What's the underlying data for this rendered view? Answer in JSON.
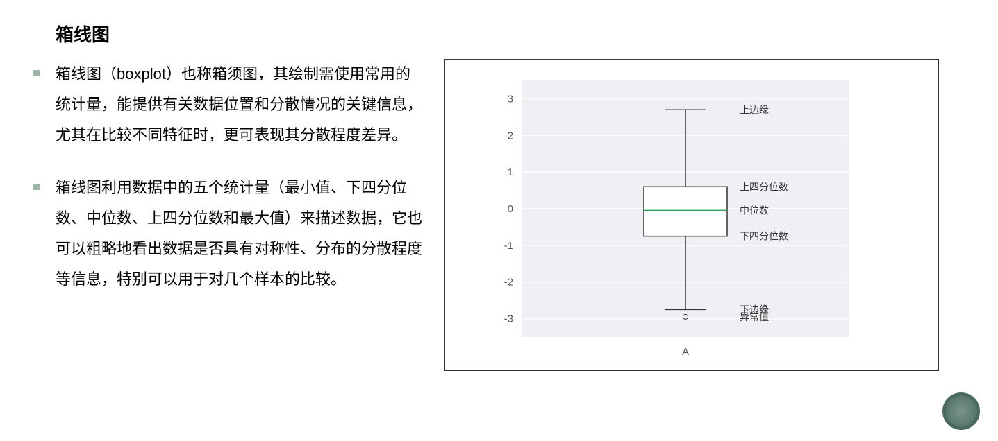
{
  "title": "箱线图",
  "bullets": [
    "箱线图（boxplot）也称箱须图，其绘制需使用常用的统计量，能提供有关数据位置和分散情况的关键信息，尤其在比较不同特征时，更可表现其分散程度差异。",
    "箱线图利用数据中的五个统计量（最小值、下四分位数、中位数、上四分位数和最大值）来描述数据，它也可以粗略地看出数据是否具有对称性、分布的分散程度等信息，特别可以用于对几个样本的比较。"
  ],
  "chart_data": {
    "type": "box",
    "categories": [
      "A"
    ],
    "series": [
      {
        "name": "A",
        "upper_whisker": 2.7,
        "q3": 0.6,
        "median": -0.05,
        "q1": -0.75,
        "lower_whisker": -2.75,
        "outliers": [
          -2.95
        ]
      }
    ],
    "y_ticks": [
      -3,
      -2,
      -1,
      0,
      1,
      2,
      3
    ],
    "ylim": [
      -3.5,
      3.5
    ],
    "annotations": {
      "upper_whisker": "上边缘",
      "q3": "上四分位数",
      "median": "中位数",
      "q1": "下四分位数",
      "lower_whisker": "下边缘",
      "outlier": "异常值"
    },
    "xlabel": "A"
  }
}
